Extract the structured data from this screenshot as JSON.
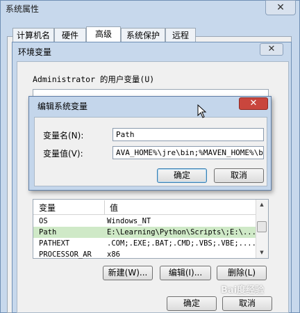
{
  "outer": {
    "title": "系统属性",
    "close": "✕",
    "tabs": [
      "计算机名",
      "硬件",
      "高级",
      "系统保护",
      "远程"
    ]
  },
  "env_dialog": {
    "title": "环境变量",
    "close": "✕",
    "user_vars_label": "Administrator 的用户变量(U)",
    "system_table": {
      "columns": [
        "变量",
        "值"
      ],
      "rows": [
        {
          "name": "OS",
          "value": "Windows_NT"
        },
        {
          "name": "Path",
          "value": "E:\\Learning\\Python\\Scripts\\;E:\\..."
        },
        {
          "name": "PATHEXT",
          "value": ".COM;.EXE;.BAT;.CMD;.VBS;.VBE;...."
        },
        {
          "name": "PROCESSOR_AR",
          "value": "x86"
        }
      ]
    },
    "buttons": {
      "new": "新建(W)...",
      "edit": "编辑(I)...",
      "delete": "删除(L)"
    },
    "ok": "确定",
    "cancel": "取消"
  },
  "edit_dialog": {
    "title": "编辑系统变量",
    "close": "✕",
    "name_label": "变量名(N):",
    "name_value": "Path",
    "value_label": "变量值(V):",
    "value_value": "AVA_HOME%\\jre\\bin;%MAVEN_HOME%\\bin;",
    "ok": "确定",
    "cancel": "取消"
  },
  "watermark": "Bai度经验"
}
